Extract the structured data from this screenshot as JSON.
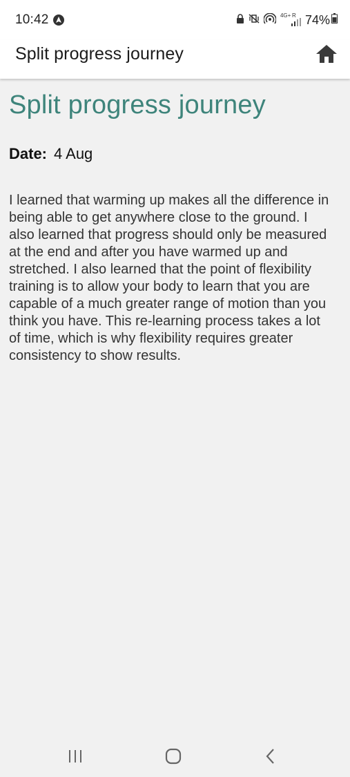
{
  "status_bar": {
    "time": "10:42",
    "battery": "74%",
    "network": "4G+",
    "roaming": "R",
    "icons": [
      "app-notification-icon",
      "lock-icon",
      "vibrate-mute-icon",
      "hotspot-icon",
      "signal-icon",
      "battery-icon"
    ]
  },
  "app_bar": {
    "title": "Split progress journey",
    "home_icon": "home-icon"
  },
  "entry": {
    "title": "Split progress journey",
    "date_label": "Date:",
    "date_value": "4 Aug",
    "body": "I learned that warming up makes all the difference in being able to get anywhere close to the ground. I also learned that progress should only be measured at the end and after you have warmed up and stretched. I also learned that the point of flexibility training is to allow your body to learn that you are capable of a much greater range of motion than you think you have. This re-learning process takes a lot of time, which is why flexibility requires greater consistency to show results."
  },
  "nav_bar": {
    "recents_icon": "recents-icon",
    "home_icon": "home-circle-icon",
    "back_icon": "back-icon"
  },
  "colors": {
    "title_accent": "#3e847b",
    "background": "#f1f1f1",
    "bar_background": "#ffffff"
  }
}
